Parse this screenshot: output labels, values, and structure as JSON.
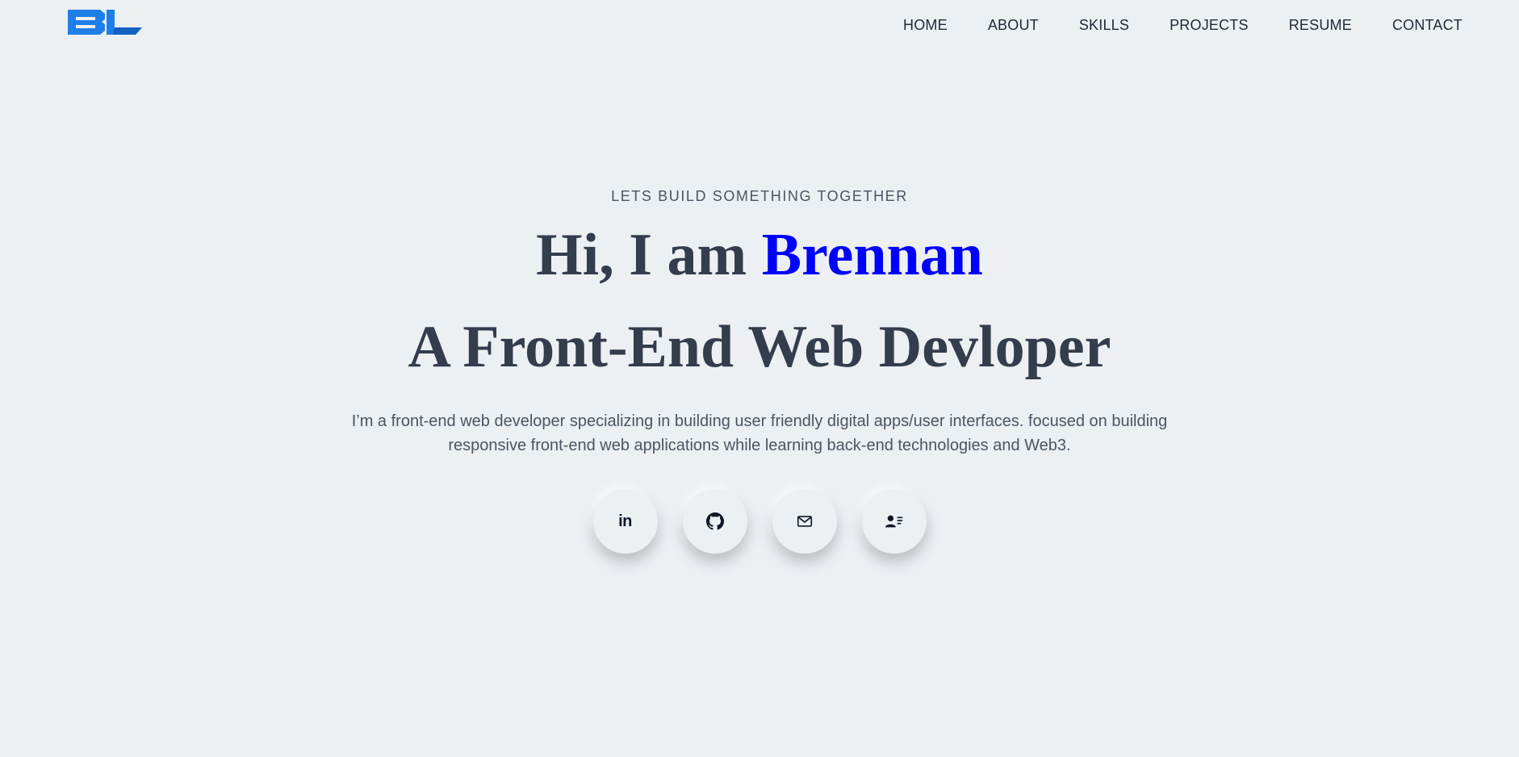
{
  "nav": {
    "logo_icon": "bl-monogram-logo",
    "brand_color": "#1f7fe8",
    "links": [
      {
        "label": "HOME"
      },
      {
        "label": "ABOUT"
      },
      {
        "label": "SKILLS"
      },
      {
        "label": "PROJECTS"
      },
      {
        "label": "RESUME"
      },
      {
        "label": "CONTACT"
      }
    ]
  },
  "hero": {
    "tagline": "LETS BUILD SOMETHING TOGETHER",
    "greeting": "Hi, I am",
    "name": "Brennan",
    "name_color": "#0000ff",
    "headline_2": "A Front-End Web Devloper",
    "bio": "I’m a front-end web developer specializing in building user friendly digital apps/user interfaces. focused on building responsive front-end web applications while learning back-end technologies and Web3."
  },
  "socials": [
    {
      "icon": "linkedin-icon",
      "glyph": "in"
    },
    {
      "icon": "github-icon"
    },
    {
      "icon": "mail-icon"
    },
    {
      "icon": "contact-card-icon"
    }
  ],
  "colors": {
    "background": "#ecf0f3",
    "heading": "#333d4c",
    "body_text": "#4b5563"
  }
}
